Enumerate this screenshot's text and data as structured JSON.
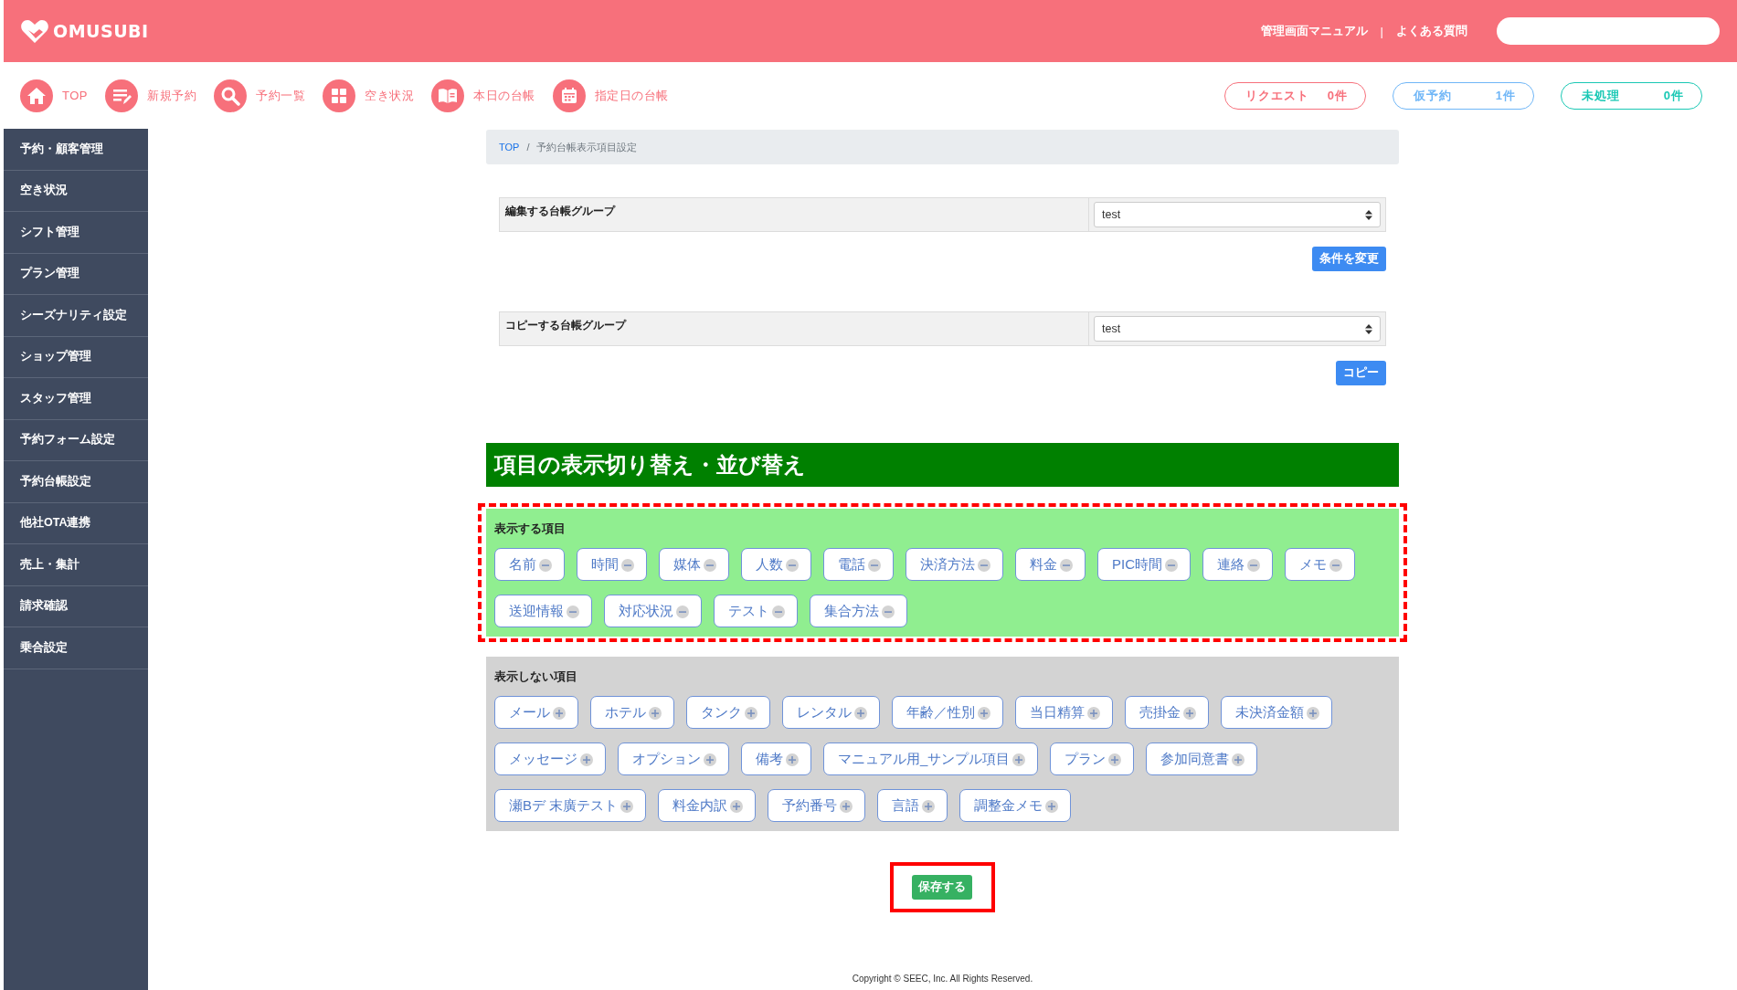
{
  "header": {
    "logo": "OMUSUBI",
    "links": [
      "管理画面マニュアル",
      "よくある質問"
    ],
    "separator": "|"
  },
  "nav": [
    {
      "label": "TOP"
    },
    {
      "label": "新規予約"
    },
    {
      "label": "予約一覧"
    },
    {
      "label": "空き状況"
    },
    {
      "label": "本日の台帳"
    },
    {
      "label": "指定日の台帳"
    }
  ],
  "status": [
    {
      "label": "リクエスト",
      "count": "0件",
      "color": "#f7707b"
    },
    {
      "label": "仮予約",
      "count": "1件",
      "color": "#6fb6f7"
    },
    {
      "label": "未処理",
      "count": "0件",
      "color": "#19c8b4"
    }
  ],
  "sidebar": {
    "items": [
      "予約・顧客管理",
      "空き状況",
      "シフト管理",
      "プラン管理",
      "シーズナリティ設定",
      "ショップ管理",
      "スタッフ管理",
      "予約フォーム設定",
      "予約台帳設定",
      "他社OTA連携",
      "売上・集計",
      "請求確認",
      "乗合設定"
    ]
  },
  "breadcrumb": {
    "separator": "/",
    "items": [
      {
        "label": "TOP",
        "kind": "link"
      },
      {
        "label": "予約台帳表示項目設定",
        "kind": "current"
      }
    ]
  },
  "forms": [
    {
      "label": "編集する台帳グループ",
      "value": "test",
      "button": "条件を変更"
    },
    {
      "label": "コピーする台帳グループ",
      "value": "test",
      "button": "コピー"
    }
  ],
  "heading": "項目の表示切り替え・並び替え",
  "sections": [
    {
      "title": "表示する項目",
      "kind": "shown",
      "highlighted": true,
      "items": [
        "名前",
        "時間",
        "媒体",
        "人数",
        "電話",
        "決済方法",
        "料金",
        "PIC時間",
        "連絡",
        "メモ",
        "送迎情報",
        "対応状況",
        "テスト",
        "集合方法"
      ]
    },
    {
      "title": "表示しない項目",
      "kind": "hidden",
      "highlighted": false,
      "items": [
        "メール",
        "ホテル",
        "タンク",
        "レンタル",
        "年齢／性別",
        "当日精算",
        "売掛金",
        "未決済金額",
        "メッセージ",
        "オプション",
        "備考",
        "マニュアル用_サンプル項目",
        "プラン",
        "参加同意書",
        "瀬Bデ 末廣テスト",
        "料金内訳",
        "予約番号",
        "言語",
        "調整金メモ"
      ]
    }
  ],
  "save": {
    "label": "保存する",
    "highlighted": true
  },
  "footer": "Copyright © SEEC, Inc. All Rights Reserved."
}
